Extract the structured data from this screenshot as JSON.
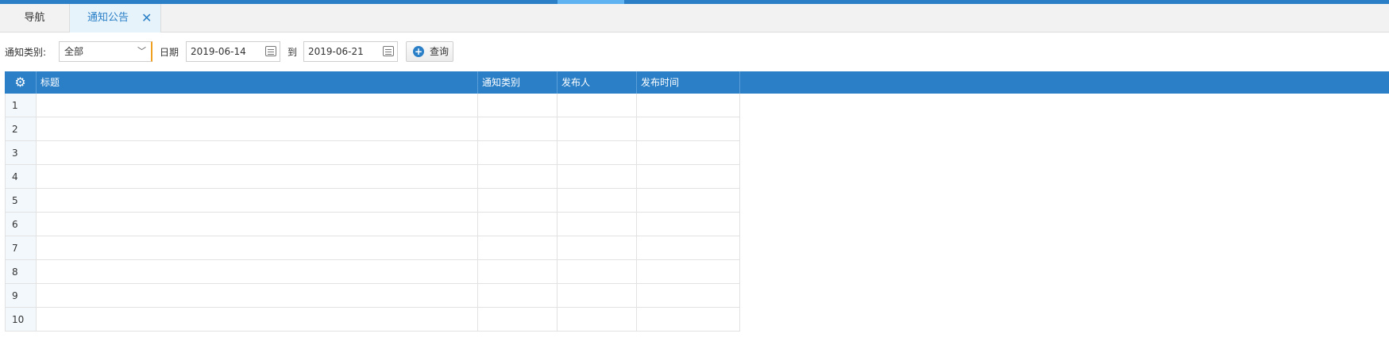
{
  "tabs": {
    "nav_label": "导航",
    "notice_label": "通知公告",
    "close_glyph": "✕"
  },
  "filters": {
    "category_label": "通知类别:",
    "category_value": "全部",
    "date_label": "日期",
    "date_from": "2019-06-14",
    "to_label": "到",
    "date_to": "2019-06-21",
    "query_label": "查询"
  },
  "grid": {
    "columns": [
      "标题",
      "通知类别",
      "发布人",
      "发布时间"
    ],
    "rows": [
      "1",
      "2",
      "3",
      "4",
      "5",
      "6",
      "7",
      "8",
      "9",
      "10"
    ]
  },
  "colors": {
    "accent": "#2a7fc7",
    "select_focus": "#f0a020"
  }
}
